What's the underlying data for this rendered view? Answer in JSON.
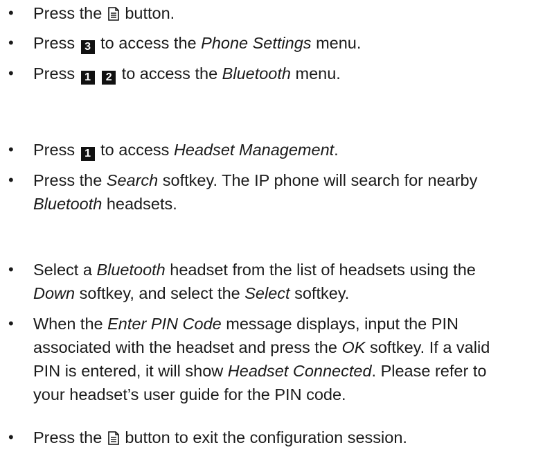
{
  "steps": [
    {
      "bullet": "•",
      "lines": [
        [
          {
            "t": "Press the "
          },
          {
            "icon": "doc-icon"
          },
          {
            "t": " button."
          }
        ]
      ]
    },
    {
      "bullet": "•",
      "lines": [
        [
          {
            "t": "Press "
          },
          {
            "key": "3"
          },
          {
            "t": " to access the "
          },
          {
            "em": "Phone Settings"
          },
          {
            "t": " menu."
          }
        ]
      ]
    },
    {
      "bullet": "•",
      "lines": [
        [
          {
            "t": "Press "
          },
          {
            "key": "1"
          },
          {
            "t": " "
          },
          {
            "key": "2"
          },
          {
            "t": " to access the "
          },
          {
            "em": "Bluetooth"
          },
          {
            "t": " menu."
          }
        ]
      ]
    },
    {
      "bullet": "•",
      "lines": [
        [
          {
            "t": "Press "
          },
          {
            "key": "1"
          },
          {
            "t": " to access "
          },
          {
            "em": "Headset Management"
          },
          {
            "t": "."
          }
        ]
      ]
    },
    {
      "bullet": "•",
      "lines": [
        [
          {
            "t": "Press the "
          },
          {
            "em": "Search"
          },
          {
            "t": " softkey. The IP phone will search for nearby"
          }
        ],
        [
          {
            "em": "Bluetooth"
          },
          {
            "t": " headsets."
          }
        ]
      ]
    },
    {
      "bullet": "•",
      "lines": [
        [
          {
            "t": "Select a "
          },
          {
            "em": "Bluetooth"
          },
          {
            "t": " headset from the list of headsets using the"
          }
        ],
        [
          {
            "em": "Down"
          },
          {
            "t": " softkey, and select the "
          },
          {
            "em": "Select"
          },
          {
            "t": " softkey."
          }
        ]
      ]
    },
    {
      "bullet": "•",
      "lines": [
        [
          {
            "t": "When the "
          },
          {
            "em": "Enter PIN Code"
          },
          {
            "t": " message displays, input the PIN"
          }
        ],
        [
          {
            "t": "associated with the headset and press the "
          },
          {
            "em": "OK"
          },
          {
            "t": " softkey. If a valid"
          }
        ],
        [
          {
            "t": "PIN is entered, it will show "
          },
          {
            "em": "Headset Connected"
          },
          {
            "t": ". Please refer to"
          }
        ],
        [
          {
            "t": "your headset’s user guide for the PIN code."
          }
        ]
      ]
    },
    {
      "bullet": "•",
      "lines": [
        [
          {
            "t": "Press the "
          },
          {
            "icon": "doc-icon"
          },
          {
            "t": " button to exit the configuration session."
          }
        ]
      ]
    }
  ]
}
